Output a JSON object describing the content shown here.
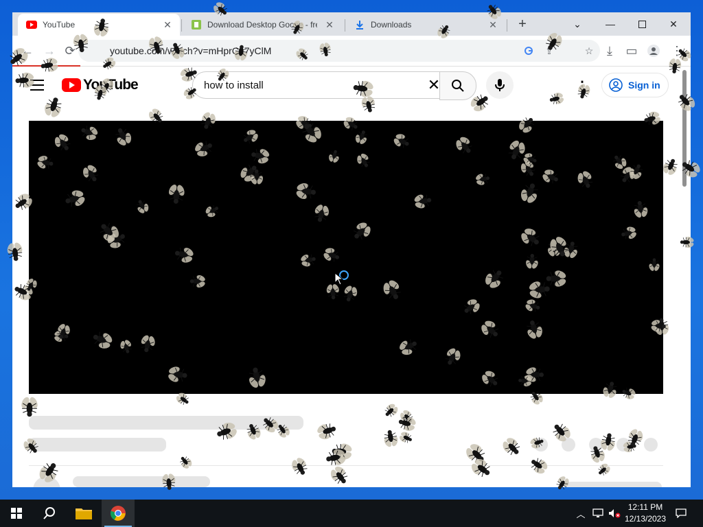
{
  "browser": {
    "tabs": [
      {
        "title": "YouTube",
        "icon": "youtube-favicon"
      },
      {
        "title": "Download Desktop Goose - free",
        "icon": "download-site-favicon"
      },
      {
        "title": "Downloads",
        "icon": "download-icon"
      }
    ],
    "url": "youtube.com/watch?v=mHprCa7yClM",
    "loading_progress": 0.1
  },
  "youtube": {
    "logo_text": "YouTube",
    "search_value": "how to install",
    "signin_label": "Sign in"
  },
  "taskbar": {
    "time": "12:11 PM",
    "date": "12/13/2023"
  },
  "colors": {
    "brand_red": "#ff0000",
    "link_blue": "#065fd4",
    "desktop_blue": "#1a74e0"
  }
}
